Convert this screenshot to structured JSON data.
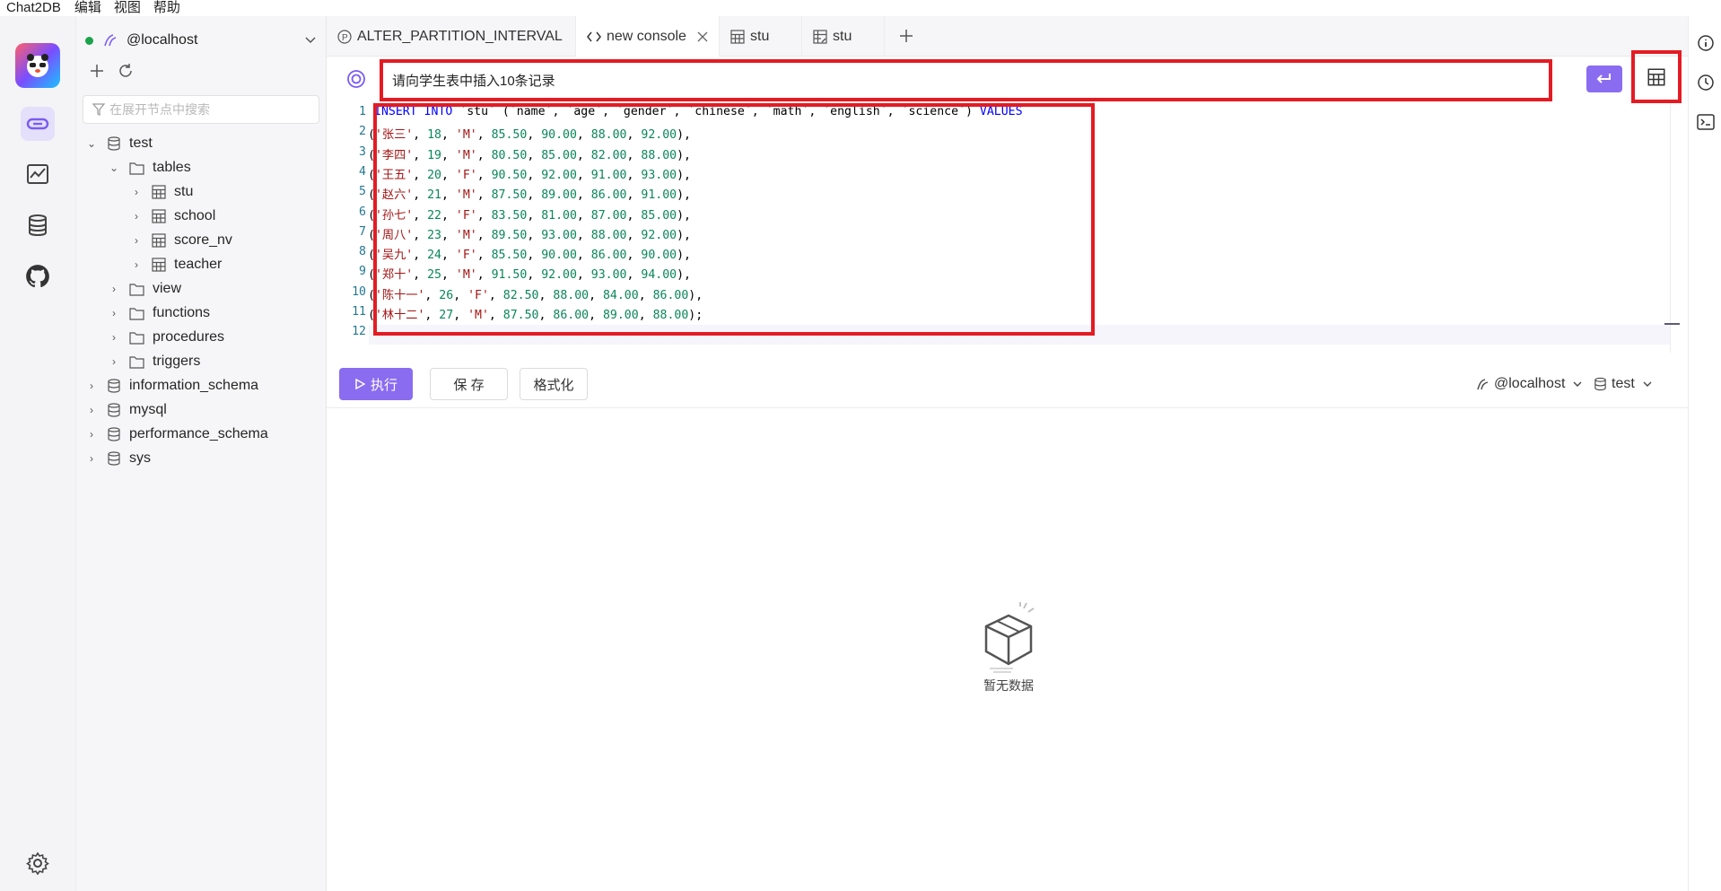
{
  "menu": [
    "Chat2DB",
    "编辑",
    "视图",
    "帮助"
  ],
  "sidebar": {
    "connection": "@localhost",
    "search_placeholder": "在展开节点中搜索",
    "tree": {
      "db_test": "test",
      "folder_tables": "tables",
      "tables": [
        "stu",
        "school",
        "score_nv",
        "teacher"
      ],
      "folders": [
        "view",
        "functions",
        "procedures",
        "triggers"
      ],
      "other_dbs": [
        "information_schema",
        "mysql",
        "performance_schema",
        "sys"
      ]
    }
  },
  "tabs": [
    {
      "label": "ALTER_PARTITION_INTERVAL",
      "icon": "procedure-icon"
    },
    {
      "label": "new console",
      "icon": "code-icon",
      "active": true
    },
    {
      "label": "stu",
      "icon": "table-icon"
    },
    {
      "label": "stu",
      "icon": "table-edit-icon"
    }
  ],
  "prompt": {
    "text": "请向学生表中插入10条记录"
  },
  "editor": {
    "line_numbers": [
      "1",
      "2",
      "3",
      "4",
      "5",
      "6",
      "7",
      "8",
      "9",
      "10",
      "11",
      "12"
    ],
    "header": {
      "kw1": "INSERT INTO",
      "mid": " `stu` (`name`, `age`, `gender`, `chinese`, `math`, `english`, `science`) ",
      "kw2": "VALUES"
    },
    "rows": [
      {
        "name": "'张三'",
        "age": "18",
        "gender": "'M'",
        "c": "85.50",
        "m": "90.00",
        "e": "88.00",
        "s": "92.00",
        "end": "),"
      },
      {
        "name": "'李四'",
        "age": "19",
        "gender": "'M'",
        "c": "80.50",
        "m": "85.00",
        "e": "82.00",
        "s": "88.00",
        "end": "),"
      },
      {
        "name": "'王五'",
        "age": "20",
        "gender": "'F'",
        "c": "90.50",
        "m": "92.00",
        "e": "91.00",
        "s": "93.00",
        "end": "),"
      },
      {
        "name": "'赵六'",
        "age": "21",
        "gender": "'M'",
        "c": "87.50",
        "m": "89.00",
        "e": "86.00",
        "s": "91.00",
        "end": "),"
      },
      {
        "name": "'孙七'",
        "age": "22",
        "gender": "'F'",
        "c": "83.50",
        "m": "81.00",
        "e": "87.00",
        "s": "85.00",
        "end": "),"
      },
      {
        "name": "'周八'",
        "age": "23",
        "gender": "'M'",
        "c": "89.50",
        "m": "93.00",
        "e": "88.00",
        "s": "92.00",
        "end": "),"
      },
      {
        "name": "'吴九'",
        "age": "24",
        "gender": "'F'",
        "c": "85.50",
        "m": "90.00",
        "e": "86.00",
        "s": "90.00",
        "end": "),"
      },
      {
        "name": "'郑十'",
        "age": "25",
        "gender": "'M'",
        "c": "91.50",
        "m": "92.00",
        "e": "93.00",
        "s": "94.00",
        "end": "),"
      },
      {
        "name": "'陈十一'",
        "age": "26",
        "gender": "'F'",
        "c": "82.50",
        "m": "88.00",
        "e": "84.00",
        "s": "86.00",
        "end": "),"
      },
      {
        "name": "'林十二'",
        "age": "27",
        "gender": "'M'",
        "c": "87.50",
        "m": "86.00",
        "e": "89.00",
        "s": "88.00",
        "end": ");"
      }
    ]
  },
  "toolbar": {
    "run_label": "执行",
    "save_label": "保 存",
    "format_label": "格式化",
    "connection_select": "@localhost",
    "database_select": "test"
  },
  "empty_state": {
    "text": "暂无数据"
  },
  "colors": {
    "accent": "#8a6cf0",
    "highlight_box": "#e41b23",
    "connected_dot": "#1aa34a"
  }
}
